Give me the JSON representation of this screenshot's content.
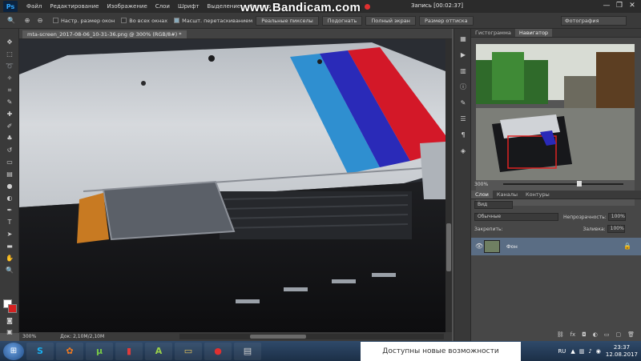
{
  "menubar": {
    "logo": "Ps",
    "items": [
      "Файл",
      "Редактирование",
      "Изображение",
      "Слои",
      "Шрифт",
      "Выделение",
      "Фильтр"
    ],
    "watermark": "www.Bandicam.com",
    "recording_label": "Запись [00:02:37]"
  },
  "options": {
    "checkboxes": [
      {
        "label": "Настр. размер окон",
        "checked": false
      },
      {
        "label": "Во всех окнах",
        "checked": false
      },
      {
        "label": "Масшт. перетаскиванием",
        "checked": true
      }
    ],
    "buttons": [
      "Реальные пикселы",
      "Подогнать",
      "Полный экран",
      "Размер оттиска"
    ],
    "workspace": "Фотография"
  },
  "document": {
    "tab_title": "mta-screen_2017-08-06_10-31-36.png @ 300% (RGB/8#) *",
    "zoom": "300%",
    "doc_size": "Док: 2,10M/2,10M"
  },
  "panels": {
    "top_tabs": [
      "Гистограмма",
      "Навигатор"
    ],
    "navigator_zoom": "300%",
    "layer_tabs": [
      "Слои",
      "Каналы",
      "Контуры"
    ],
    "filter_kind": "Вид",
    "blend_mode": "Обычные",
    "opacity_label": "Непрозрачность:",
    "opacity_value": "100%",
    "lock_label": "Закрепить:",
    "fill_label": "Заливка:",
    "fill_value": "100%",
    "layer_name": "Фон"
  },
  "taskbar": {
    "notification": "Доступны новые возможности",
    "lang": "RU",
    "time": "23:37",
    "date": "12.08.2017"
  },
  "colors": {
    "foreground": "#ffffff",
    "background": "#d32020",
    "accent_selection": "#5a6d84"
  }
}
